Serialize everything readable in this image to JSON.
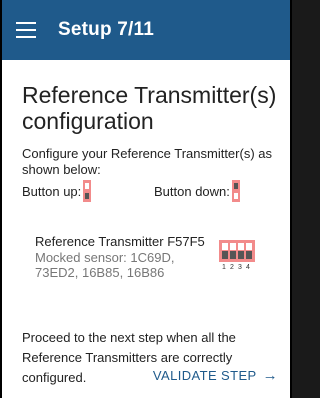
{
  "appbar": {
    "title": "Setup 7/11",
    "menu_icon": "hamburger-menu-icon"
  },
  "page": {
    "heading": "Reference Transmitter(s) configuration",
    "instructions": "Configure your Reference Transmitter(s) as shown below:",
    "legend": {
      "up_label": "Button up:",
      "down_label": "Button down:"
    },
    "transmitter": {
      "name": "Reference Transmitter F57F5",
      "sensors": "Mocked sensor: 1C69D, 73ED2, 16B85, 16B86",
      "dip_labels": [
        "1",
        "2",
        "3",
        "4"
      ],
      "dip_color": "#f28b8b"
    },
    "proceed_text": "Proceed to the next step when all the Reference Transmitters are correctly configured.",
    "validate_label": "VALIDATE STEP",
    "validate_icon": "arrow-right-icon"
  },
  "colors": {
    "appbar": "#1f5a8b",
    "accent": "#1f5a8b",
    "switch": "#f28b8b"
  }
}
